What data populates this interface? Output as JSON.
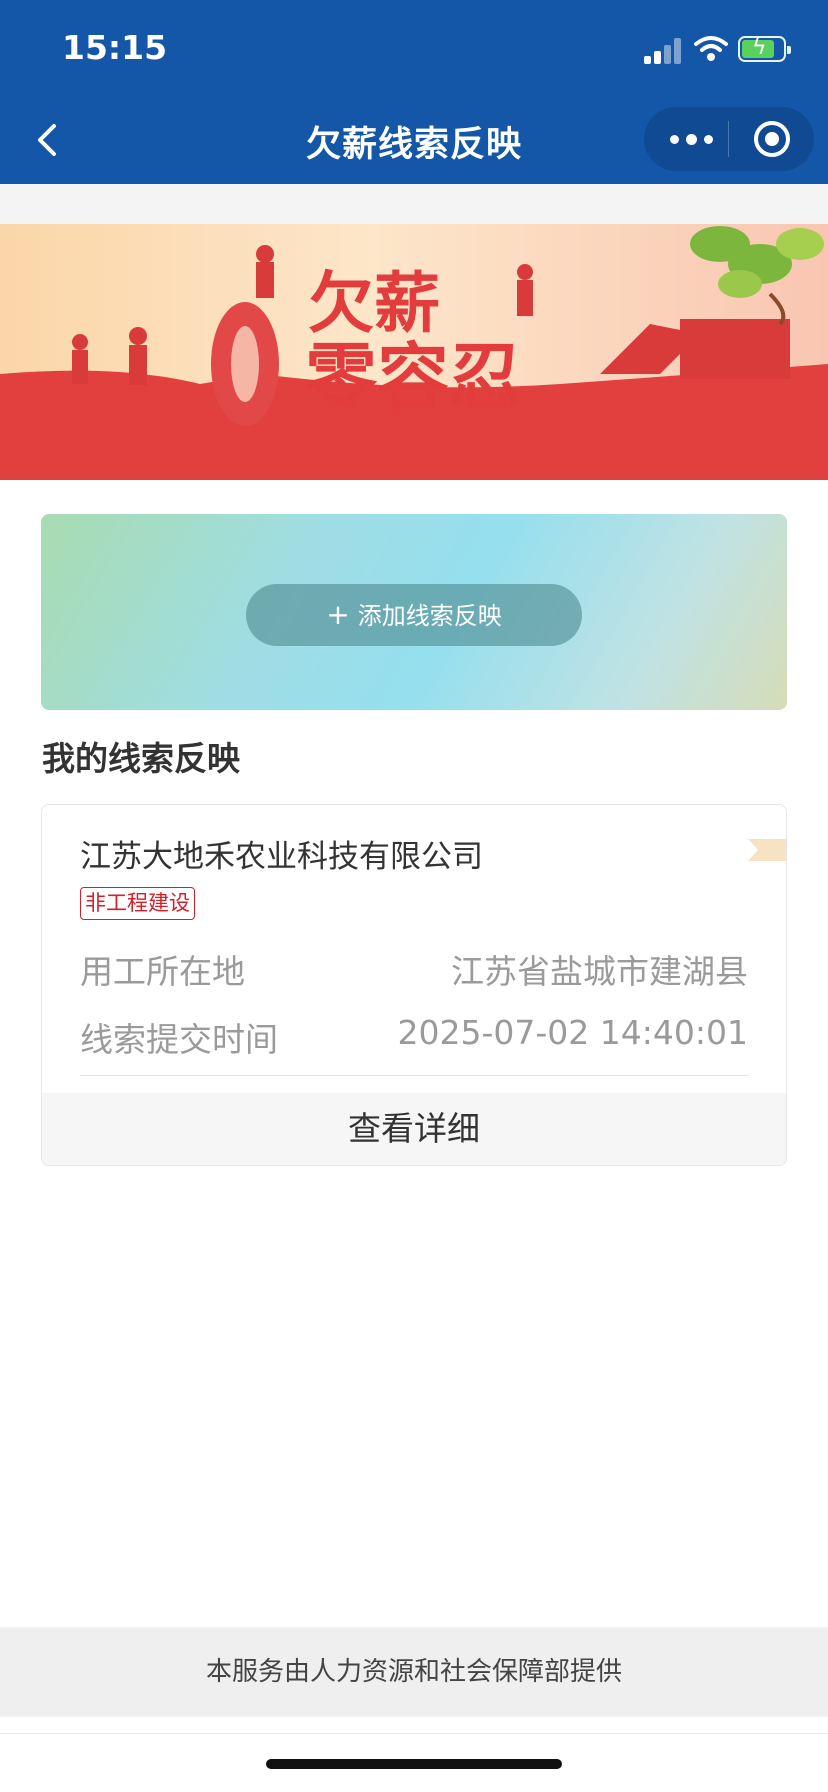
{
  "status_bar": {
    "time": "15:15"
  },
  "nav": {
    "title": "欠薪线索反映"
  },
  "banner": {
    "headline_line1": "欠薪",
    "headline_line2": "零容忍",
    "big_char": "0"
  },
  "add_card": {
    "button_label": "添加线索反映",
    "plus": "+"
  },
  "section": {
    "title": "我的线索反映"
  },
  "record": {
    "company": "江苏大地禾农业科技有限公司",
    "tag": "非工程建设",
    "rows": [
      {
        "label": "用工所在地",
        "value": "江苏省盐城市建湖县"
      },
      {
        "label": "线索提交时间",
        "value": "2025-07-02 14:40:01"
      }
    ],
    "detail_button": "查看详细"
  },
  "footer": {
    "text": "本服务由人力资源和社会保障部提供"
  },
  "colors": {
    "nav_blue": "#1457a8",
    "banner_red": "#e2403f",
    "tag_red": "#d0202a"
  }
}
